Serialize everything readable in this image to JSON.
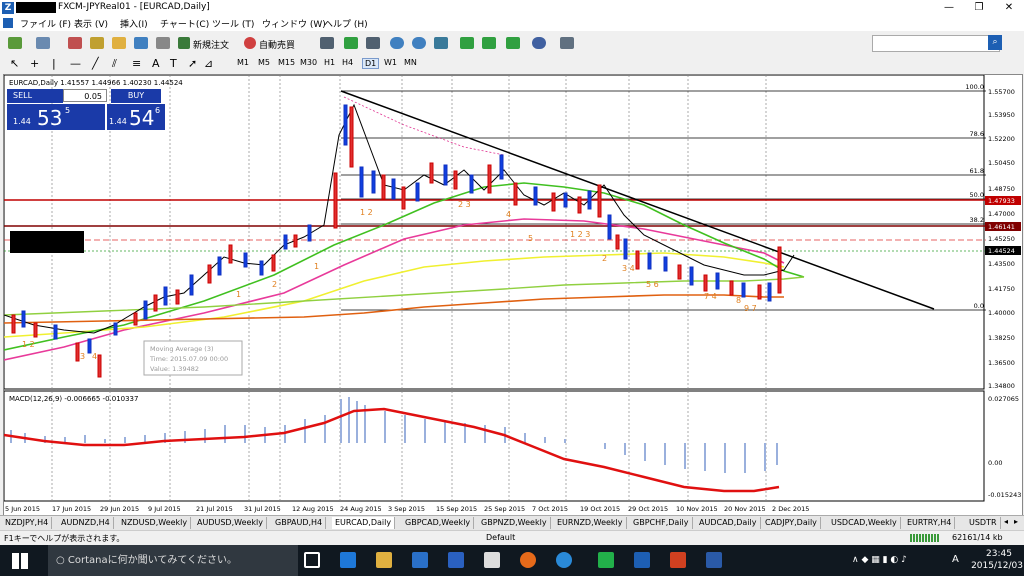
{
  "window": {
    "title": "FXCM-JPYReal01 - [EURCAD,Daily]",
    "controls": [
      "—",
      "❐",
      "✕"
    ]
  },
  "menu": [
    "ファイル (F)",
    "表示 (V)",
    "挿入(I)",
    "チャート(C)",
    "ツール (T)",
    "ウィンドウ (W)",
    "ヘルプ (H)"
  ],
  "toolbar": {
    "new_order": "新規注文",
    "auto_trade": "自動売買"
  },
  "timeframes": [
    "M1",
    "M5",
    "M15",
    "M30",
    "H1",
    "H4",
    "D1",
    "W1",
    "MN"
  ],
  "active_timeframe": "D1",
  "chart": {
    "symbol_header": "EURCAD,Daily  1.41557 1.44966 1.40230 1.44524",
    "indicator_label": "MACD(12,26,9) -0.006665 -0.010337",
    "trade": {
      "sell_label": "SELL",
      "buy_label": "BUY",
      "lot": "0.05",
      "sell_prefix": "1.44",
      "sell_big": "53",
      "sell_sup": "5",
      "buy_prefix": "1.44",
      "buy_big": "54",
      "buy_sup": "6"
    },
    "tooltip": [
      "Moving Average (3)",
      "Time: 2015.07.09 00:00",
      "Value: 1.39482"
    ],
    "fib_labels": [
      "100.0",
      "78.6",
      "61.8",
      "50.0",
      "38.2",
      "0.0"
    ],
    "price_axis": [
      "1.55700",
      "1.53950",
      "1.52200",
      "1.50450",
      "1.48750",
      "1.47000",
      "1.45250",
      "1.43500",
      "1.41750",
      "1.40000",
      "1.38250",
      "1.36500",
      "1.34800"
    ],
    "price_tags": {
      "red_upper": "1.47933",
      "red_lower": "1.46141",
      "current": "1.44524"
    },
    "macd_axis": [
      "0.027065",
      "0.00",
      "-0.015243"
    ],
    "date_axis": [
      "5 Jun 2015",
      "17 Jun 2015",
      "29 Jun 2015",
      "9 Jul 2015",
      "21 Jul 2015",
      "31 Jul 2015",
      "12 Aug 2015",
      "24 Aug 2015",
      "3 Sep 2015",
      "15 Sep 2015",
      "25 Sep 2015",
      "7 Oct 2015",
      "19 Oct 2015",
      "29 Oct 2015",
      "10 Nov 2015",
      "20 Nov 2015",
      "2 Dec 2015"
    ]
  },
  "tabs": [
    "NZDJPY,H4",
    "AUDNZD,H4",
    "NZDUSD,Weekly",
    "AUDUSD,Weekly",
    "GBPAUD,H4",
    "EURCAD,Daily",
    "GBPCAD,Weekly",
    "GBPNZD,Weekly",
    "EURNZD,Weekly",
    "GBPCHF,Daily",
    "AUDCAD,Daily",
    "CADJPY,Daily",
    "USDCAD,Weekly",
    "EURTRY,H4",
    "USDTR"
  ],
  "active_tab": "EURCAD,Daily",
  "status": {
    "help": "F1キーでヘルプが表示されます。",
    "profile": "Default",
    "traffic": "62161/14 kb"
  },
  "taskbar": {
    "cortana": "Cortanaに何か聞いてみてください。",
    "time": "23:45",
    "date": "2015/12/03",
    "ime": "A"
  }
}
